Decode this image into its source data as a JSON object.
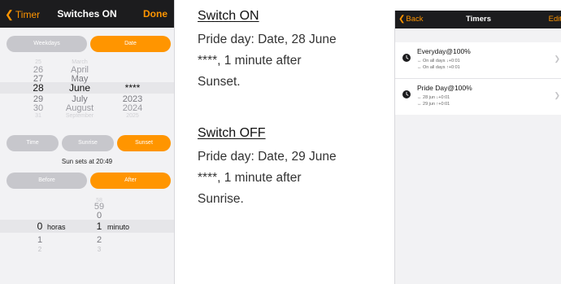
{
  "switch_screen": {
    "back_label": "Timer",
    "title": "Switches ON",
    "done_label": "Done",
    "mode_tabs": [
      {
        "label": "Weekdays",
        "selected": false
      },
      {
        "label": "Date",
        "selected": true
      }
    ],
    "date_picker": {
      "rows": [
        {
          "day": "25",
          "month": "March",
          "year": ""
        },
        {
          "day": "26",
          "month": "April",
          "year": ""
        },
        {
          "day": "27",
          "month": "May",
          "year": ""
        },
        {
          "day": "28",
          "month": "June",
          "year": "****"
        },
        {
          "day": "29",
          "month": "July",
          "year": "2023"
        },
        {
          "day": "30",
          "month": "August",
          "year": "2024"
        },
        {
          "day": "31",
          "month": "September",
          "year": "2025"
        }
      ],
      "selected_index": 3
    },
    "event_tabs": [
      {
        "label": "Time",
        "selected": false
      },
      {
        "label": "Sunrise",
        "selected": false
      },
      {
        "label": "Sunset",
        "selected": true
      }
    ],
    "sun_sets_text": "Sun sets at 20:49",
    "offset_tabs": [
      {
        "label": "Before",
        "selected": false
      },
      {
        "label": "After",
        "selected": true
      }
    ],
    "offset_picker": {
      "rows": [
        {
          "hours": "",
          "minutes": "58"
        },
        {
          "hours": "",
          "minutes": "59"
        },
        {
          "hours": "",
          "minutes": "0"
        },
        {
          "hours": "0",
          "minutes": "1"
        },
        {
          "hours": "1",
          "minutes": "2"
        },
        {
          "hours": "2",
          "minutes": "3"
        }
      ],
      "selected_index": 3,
      "hours_unit": "horas",
      "minutes_unit": "minuto"
    }
  },
  "instructions": {
    "switch_on_heading": "Switch ON",
    "switch_on_text": "Pride day: Date, 28 June ****, 1 minute after Sunset.",
    "switch_off_heading": "Switch OFF",
    "switch_off_text": "Pride day: Date, 29 June ****, 1 minute after Sunrise."
  },
  "timers_screen": {
    "back_label": "Back",
    "title": "Timers",
    "edit_label": "Edit",
    "items": [
      {
        "title": "Everyday@100%",
        "on_line": "↔ On all days ↓+0:01",
        "off_line": "↔ On all days ↑+0:01"
      },
      {
        "title": "Pride Day@100%",
        "on_line": "↔ 28 jun ↓+0:01",
        "off_line": "↔ 29 jun ↑+0:01"
      }
    ]
  },
  "colors": {
    "accent": "#ff9500",
    "segment_off": "#c7c7cc",
    "nav_bar": "#1c1c1e",
    "background": "#f2f2f4"
  }
}
